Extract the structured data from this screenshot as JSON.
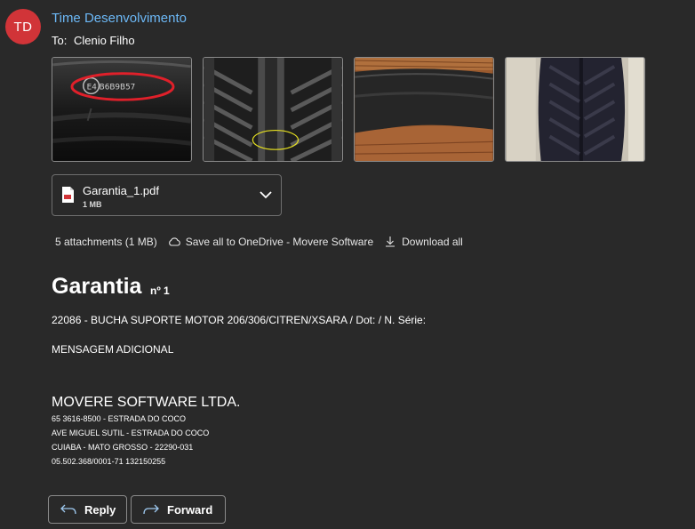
{
  "header": {
    "avatar_initials": "TD",
    "avatar_color": "#d13438",
    "sender": "Time Desenvolvimento",
    "to_prefix": "To:",
    "recipient": "Clenio Filho",
    "sender_color": "#6cb8f6"
  },
  "images": [
    {
      "icon": "tire-sidewall-photo",
      "overlay_text": "E4 B6B9B57"
    },
    {
      "icon": "tire-tread-photo"
    },
    {
      "icon": "worn-tire-photo"
    },
    {
      "icon": "tread-closeup-photo"
    }
  ],
  "attachment": {
    "name": "Garantia_1.pdf",
    "size": "1 MB",
    "icon": "pdf-icon"
  },
  "attachments_bar": {
    "summary": "5 attachments (1 MB)",
    "save_label": "Save all to OneDrive - Movere Software",
    "download_label": "Download all"
  },
  "message": {
    "title": "Garantia",
    "title_sub": "nº 1",
    "line1": "22086 - BUCHA SUPORTE MOTOR 206/306/CITREN/XSARA / Dot: / N. Série:",
    "line2": "MENSAGEM ADICIONAL",
    "company": "MOVERE SOFTWARE LTDA.",
    "address": [
      "65 3616-8500 - ESTRADA DO COCO",
      "AVE MIGUEL SUTIL - ESTRADA DO COCO",
      "CUIABA - MATO GROSSO - 22290-031",
      "05.502.368/0001-71  132150255"
    ]
  },
  "actions": {
    "reply_label": "Reply",
    "forward_label": "Forward"
  }
}
